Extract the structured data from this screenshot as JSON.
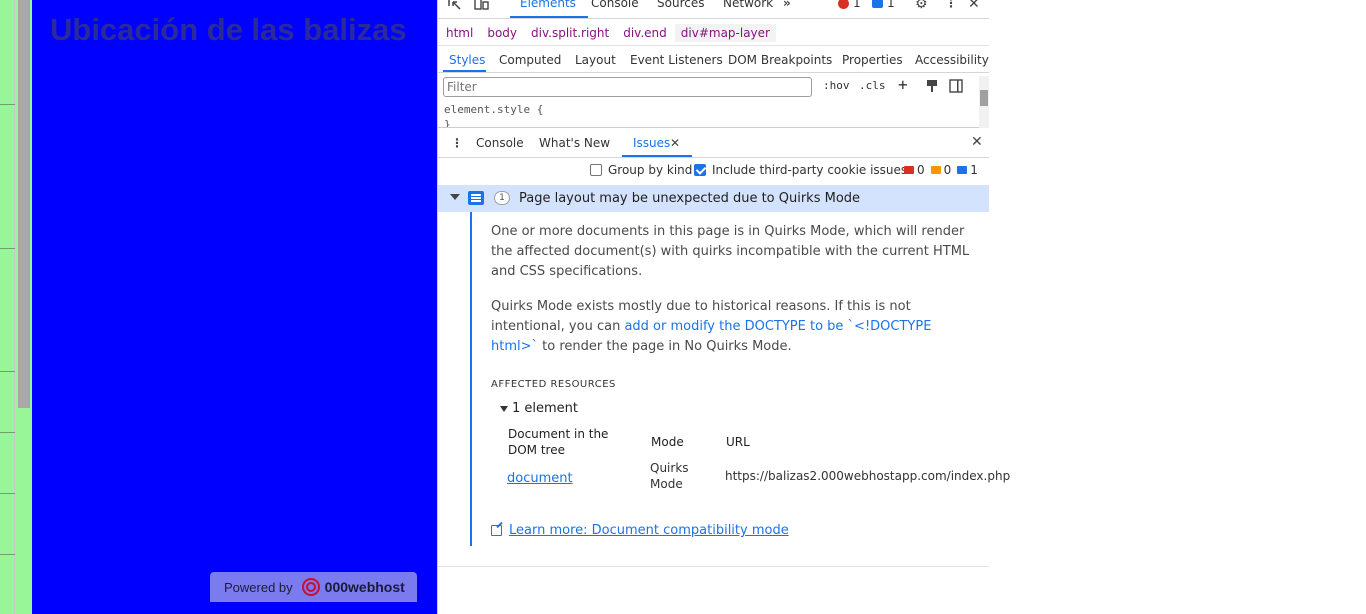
{
  "page": {
    "title": "Ubicación de las balizas",
    "powered_prefix": "Powered by",
    "powered_brand": "000webhost"
  },
  "devtools": {
    "tabs": [
      "Elements",
      "Console",
      "Sources",
      "Network"
    ],
    "more_tabs": "»",
    "error_count": "1",
    "message_count": "1",
    "breadcrumb": [
      "html",
      "body",
      "div.split.right",
      "div.end",
      "div#map-layer"
    ],
    "subtabs": [
      "Styles",
      "Computed",
      "Layout",
      "Event Listeners",
      "DOM Breakpoints",
      "Properties",
      "Accessibility"
    ],
    "filter_placeholder": "Filter",
    "hov": ":hov",
    "cls": ".cls",
    "style_line1": "element.style {",
    "style_line2": "}",
    "drawer_tabs": [
      "Console",
      "What's New",
      "Issues"
    ],
    "group_by_kind": "Group by kind",
    "include_third_party": "Include third-party cookie issues",
    "counts": {
      "red": "0",
      "orange": "0",
      "blue": "1"
    },
    "issue": {
      "count": "1",
      "title": "Page layout may be unexpected due to Quirks Mode",
      "para1": "One or more documents in this page is in Quirks Mode, which will render the affected document(s) with quirks incompatible with the current HTML and CSS specifications.",
      "para2_before": "Quirks Mode exists mostly due to historical reasons. If this is not intentional, you can ",
      "para2_link": "add or modify the DOCTYPE to be `<!DOCTYPE html>`",
      "para2_after": " to render the page in No Quirks Mode.",
      "affected_resources": "AFFECTED RESOURCES",
      "element_toggle": "1 element",
      "col_doc": "Document in the DOM tree",
      "col_mode": "Mode",
      "col_url": "URL",
      "row_doc": "document",
      "row_mode": "Quirks Mode",
      "row_url": "https://balizas2.000webhostapp.com/index.php",
      "learn_more": "Learn more: Document compatibility mode"
    }
  },
  "colors": {
    "page_bg": "#0000ff",
    "left_strip": "#98f598",
    "accent": "#1a73e8",
    "issue_header_bg": "#d3e3fd"
  }
}
